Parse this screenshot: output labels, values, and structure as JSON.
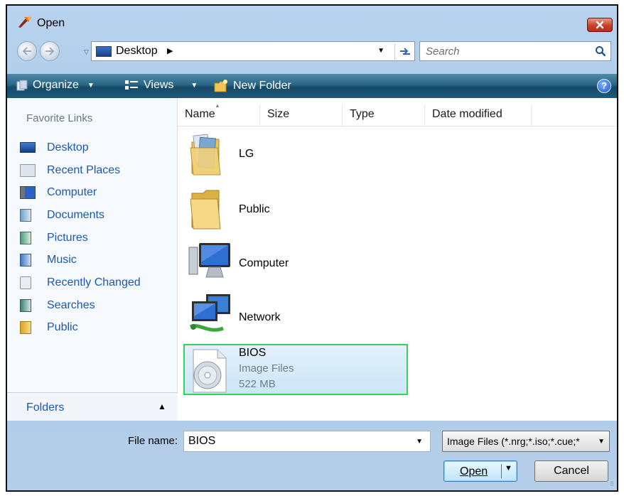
{
  "window": {
    "title": "Open"
  },
  "nav": {
    "address": "Desktop",
    "search_placeholder": "Search"
  },
  "toolbar": {
    "organize": "Organize",
    "views": "Views",
    "new_folder": "New Folder"
  },
  "sidebar": {
    "header": "Favorite Links",
    "items": [
      {
        "label": "Desktop",
        "icon": "desktop-icon"
      },
      {
        "label": "Recent Places",
        "icon": "recent-places-icon"
      },
      {
        "label": "Computer",
        "icon": "computer-icon"
      },
      {
        "label": "Documents",
        "icon": "documents-icon"
      },
      {
        "label": "Pictures",
        "icon": "pictures-icon"
      },
      {
        "label": "Music",
        "icon": "music-icon"
      },
      {
        "label": "Recently Changed",
        "icon": "recently-changed-icon"
      },
      {
        "label": "Searches",
        "icon": "searches-icon"
      },
      {
        "label": "Public",
        "icon": "public-folder-icon"
      }
    ],
    "folders_label": "Folders"
  },
  "columns": [
    "Name",
    "Size",
    "Type",
    "Date modified"
  ],
  "files": [
    {
      "name": "LG",
      "icon": "folder-icon"
    },
    {
      "name": "Public",
      "icon": "folder-icon"
    },
    {
      "name": "Computer",
      "icon": "computer-icon"
    },
    {
      "name": "Network",
      "icon": "network-icon"
    },
    {
      "name": "BIOS",
      "type": "Image Files",
      "size": "522 MB",
      "icon": "disc-image-icon",
      "selected": true
    }
  ],
  "bottom": {
    "file_name_label": "File name:",
    "file_name_value": "BIOS",
    "file_type_value": "Image Files (*.nrg;*.iso;*.cue;*",
    "open_label": "Open",
    "cancel_label": "Cancel"
  },
  "colors": {
    "accent_link": "#1b58b4",
    "toolbar": "#1d5a78",
    "selection_border": "#37d05a"
  }
}
